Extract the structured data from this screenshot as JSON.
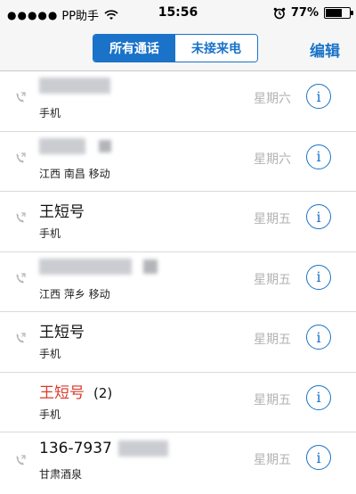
{
  "status": {
    "carrier": "PP助手",
    "time": "15:56",
    "battery_pct": "77%",
    "battery_level": 0.77
  },
  "nav": {
    "segment_all": "所有通话",
    "segment_missed": "未接来电",
    "edit_label": "编辑"
  },
  "calls": [
    {
      "name": "",
      "count": "",
      "subtitle": "手机",
      "day": "星期六",
      "missed": false
    },
    {
      "name": "",
      "count": "",
      "subtitle": "江西 南昌 移动",
      "day": "星期六",
      "missed": false
    },
    {
      "name": "王短号",
      "count": "",
      "subtitle": "手机",
      "day": "星期五",
      "missed": false
    },
    {
      "name": "",
      "count": "",
      "subtitle": "江西 萍乡 移动",
      "day": "星期五",
      "missed": false
    },
    {
      "name": "王短号",
      "count": "",
      "subtitle": "手机",
      "day": "星期五",
      "missed": false
    },
    {
      "name": "王短号",
      "count": "(2)",
      "subtitle": "手机",
      "day": "星期五",
      "missed": true
    },
    {
      "name": "136-7937",
      "count": "",
      "subtitle": "甘肃酒泉",
      "day": "星期五",
      "missed": false
    }
  ],
  "icons": {
    "signal": "signal-dots-icon",
    "wifi": "wifi-icon",
    "alarm": "alarm-icon",
    "battery": "battery-icon",
    "outgoing_call": "outgoing-call-icon",
    "info": "info-icon"
  }
}
